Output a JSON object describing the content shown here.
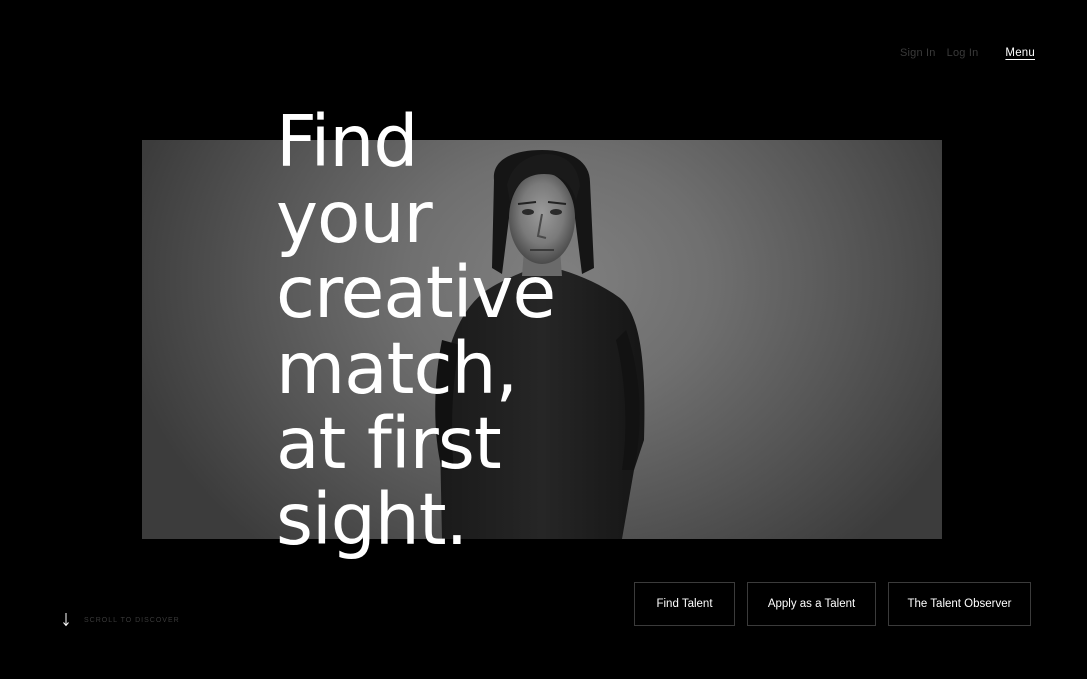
{
  "header": {
    "sign_in_label": "Sign In",
    "log_in_label": "Log In",
    "menu_label": "Menu"
  },
  "hero": {
    "headline_lines": [
      "Find",
      "your",
      "creative",
      "match,",
      "at first",
      "sight."
    ],
    "image_icon": "portrait-photo"
  },
  "scroll_hint": {
    "label": "SCROLL TO DISCOVER",
    "icon": "arrow-down-icon"
  },
  "cta": {
    "find_talent_label": "Find Talent",
    "apply_label": "Apply as a Talent",
    "observer_label": "The Talent Observer"
  },
  "colors": {
    "background": "#000000",
    "text": "#ffffff",
    "muted": "#3a3a3a",
    "button_border": "#3b3b3b"
  }
}
